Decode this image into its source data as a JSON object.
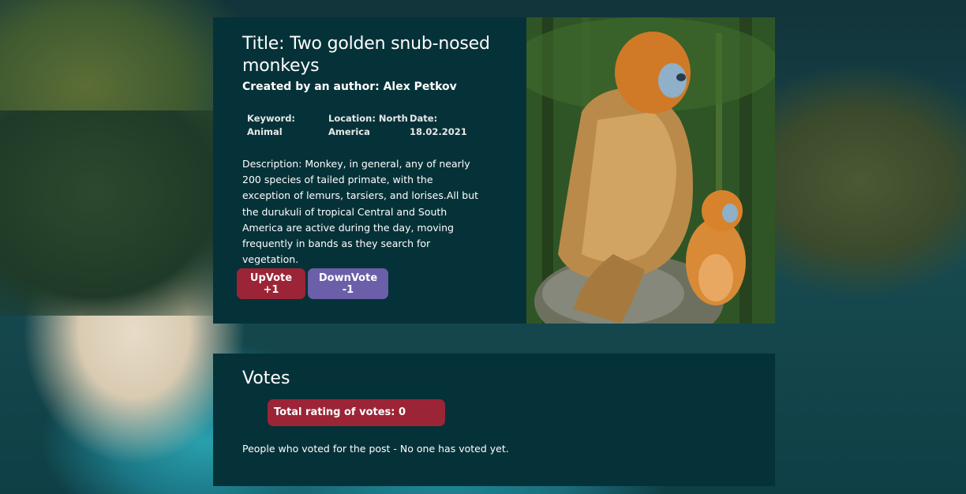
{
  "post": {
    "title": "Title: Two golden snub-nosed monkeys",
    "author": "Created by an author: Alex Petkov",
    "keyword_label": "Keyword:",
    "keyword_value": "Animal",
    "location_label": "Location: North",
    "location_value": "America",
    "date_label": "Date:",
    "date_value": "18.02.2021",
    "description": "Description: Monkey, in general, any of nearly 200 species of tailed primate, with the exception of lemurs, tarsiers, and lorises.All but the durukuli of tropical Central and South America are active during the day, moving frequently in bands as they search for vegetation.",
    "upvote_label": "UpVote +1",
    "downvote_label": "DownVote -1"
  },
  "votes": {
    "title": "Votes",
    "total_rating": "Total rating of votes: 0",
    "voters_text": "People who voted for the post - No one has voted yet."
  },
  "colors": {
    "card_bg": "#053238",
    "upvote": "#9c2437",
    "downvote": "#6a5fa8"
  }
}
